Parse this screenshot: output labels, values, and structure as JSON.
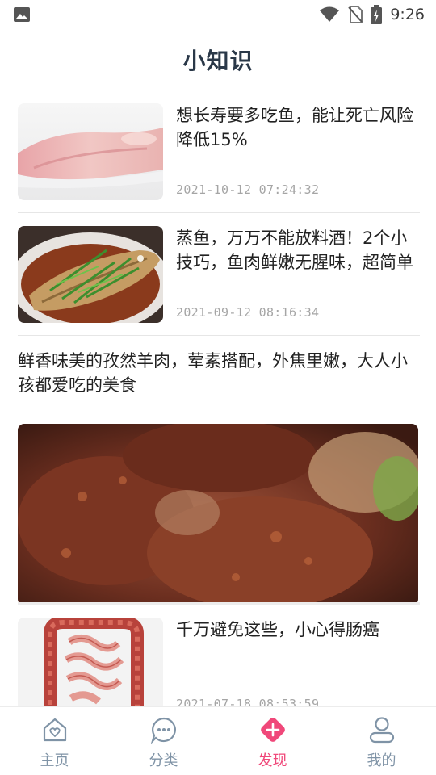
{
  "status_bar": {
    "time": "9:26",
    "icons": [
      "image-icon",
      "wifi-icon",
      "no-sim-icon",
      "battery-charging-icon"
    ]
  },
  "header": {
    "title": "小知识"
  },
  "feed": [
    {
      "layout": "thumb-left",
      "image": "raw-fish-fillet",
      "title": "想长寿要多吃鱼，能让死亡风险降低15%",
      "date": "2021-10-12 07:24:32"
    },
    {
      "layout": "thumb-left",
      "image": "steamed-fish-scallion",
      "title": "蒸鱼，万万不能放料酒！2个小技巧，鱼肉鲜嫩无腥味，超简单",
      "date": "2021-09-12 08:16:34"
    },
    {
      "layout": "hero",
      "image": "cumin-lamb",
      "title": "鲜香味美的孜然羊肉，荤素搭配，外焦里嫩，大人小孩都爱吃的美食"
    },
    {
      "layout": "thumb-left",
      "image": "intestine-illustration",
      "title": "千万避免这些，小心得肠癌",
      "date": "2021-07-18 08:53:59"
    }
  ],
  "tabs": [
    {
      "label": "主页",
      "icon": "home-heart-icon",
      "active": false
    },
    {
      "label": "分类",
      "icon": "chat-dots-icon",
      "active": false
    },
    {
      "label": "发现",
      "icon": "diamond-plus-icon",
      "active": true
    },
    {
      "label": "我的",
      "icon": "person-icon",
      "active": false
    }
  ],
  "colors": {
    "accent": "#f0487a",
    "tab_inactive": "#7f93a6",
    "title": "#2a3848",
    "date": "#a5a5a5"
  }
}
